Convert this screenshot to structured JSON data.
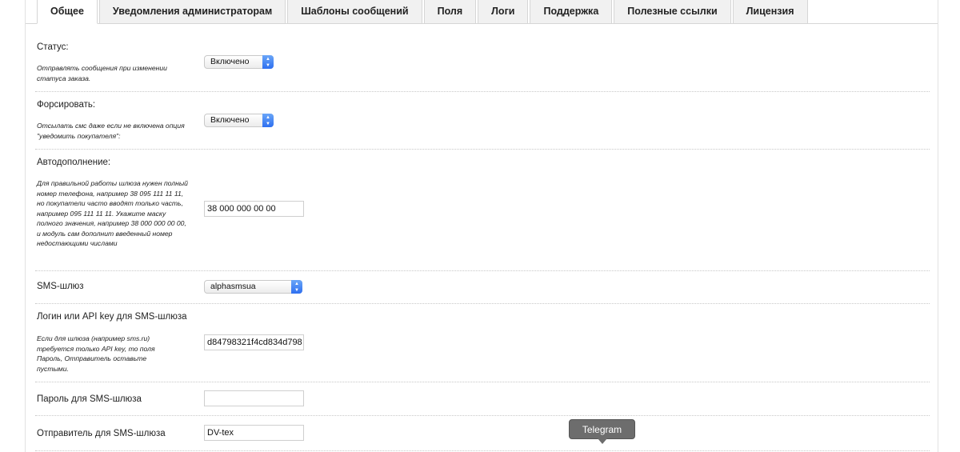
{
  "tabs": [
    {
      "label": "Общее",
      "active": true
    },
    {
      "label": "Уведомления администраторам"
    },
    {
      "label": "Шаблоны сообщений"
    },
    {
      "label": "Поля"
    },
    {
      "label": "Логи"
    },
    {
      "label": "Поддержка"
    },
    {
      "label": "Полезные ссылки"
    },
    {
      "label": "Лицензия"
    }
  ],
  "status": {
    "label": "Статус:",
    "help": "Отправлять сообщения при изменении статуса заказа.",
    "value": "Включено"
  },
  "force": {
    "label": "Форсировать:",
    "help": "Отсылать смс даже если не включена опция \"уведомить покупателя\":",
    "value": "Включено"
  },
  "autocomplete": {
    "label": "Автодополнение:",
    "help": "Для правильной работы шлюза нужен полный номер телефона, например 38 095 111 11 11, но покупатели часто вводят только часть, например 095 111 11 11. Укажите маску полного значения, например 38 000 000 00 00, и модуль сам дополнит введенный номер недостающими числами",
    "value": "38 000 000 00 00"
  },
  "gateway": {
    "label": "SMS-шлюз",
    "value": "alphasmsua"
  },
  "login": {
    "label": "Логин или API key для SMS-шлюза",
    "help": "Если для шлюза (например sms.ru) требуется только API key, то поля Пароль, Отправитель оставьте пустыми.",
    "value": "d84798321f4cd834d798"
  },
  "password": {
    "label": "Пароль для SMS-шлюза",
    "value": ""
  },
  "sender": {
    "label": "Отправитель для SMS-шлюза",
    "value": "DV-tex"
  },
  "tooltip": "Telegram",
  "colors": {
    "select_arrow": "#2e6ff0",
    "tooltip_bg": "#6d6d6d"
  }
}
